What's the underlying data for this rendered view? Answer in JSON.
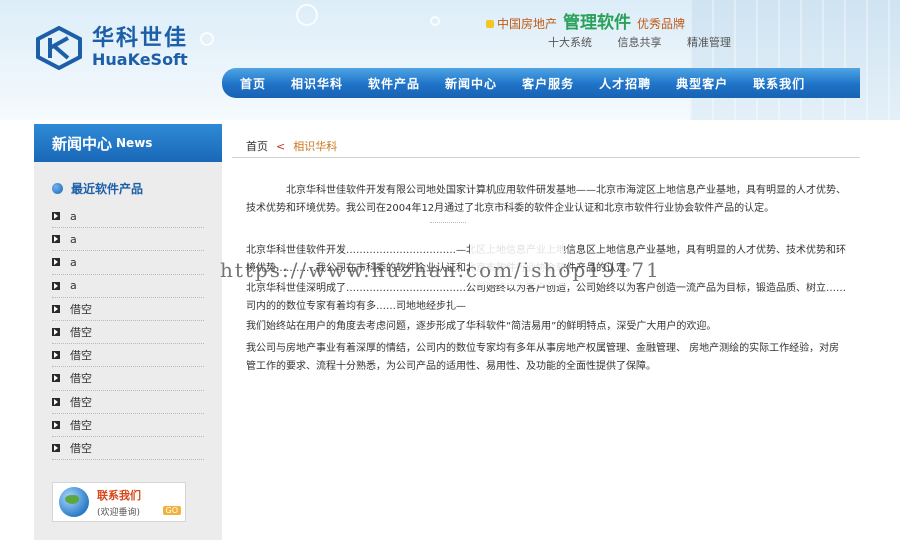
{
  "brand": {
    "name_cn": "华科世佳",
    "name_en": "HuaKeSoft",
    "accent": "#1c5ea8"
  },
  "slogan": {
    "part1": "中国房地产",
    "part2": "管理软件",
    "part3": "优秀品牌",
    "sub": [
      "十大系统",
      "信息共享",
      "精准管理"
    ]
  },
  "nav": {
    "items": [
      "首页",
      "相识华科",
      "软件产品",
      "新闻中心",
      "客户服务",
      "人才招聘",
      "典型客户",
      "联系我们"
    ],
    "color": "#1f73c8"
  },
  "sidebar": {
    "title_cn": "新闻中心",
    "title_en": "News",
    "section_label": "最近软件产品",
    "items": [
      "a",
      "a",
      "a",
      "a",
      "借空",
      "借空",
      "借空",
      "借空",
      "借空",
      "借空",
      "借空"
    ],
    "contact": {
      "title": "联系我们",
      "subtitle": "(欢迎垂询)",
      "tag": "GO"
    }
  },
  "breadcrumb": {
    "home": "首页",
    "separator": "<",
    "current": "相识华科"
  },
  "content": {
    "p1": "北京华科世佳软件开发有限公司地处国家计算机应用软件研发基地——北京市海淀区上地信息产业基地，具有明显的人才优势、技术优势和环境优势。我公司在2004年12月通过了北京市科委的软件企业认证和北京市软件行业协会软件产品的认定。",
    "p2": "北京华科世佳软件开发……………………………—北区上地信息产业上地信息区上地信息产业基地，具有明显的人才优势、技术优势和环境优势…………我公司在市科委的软件企业认证和北京市软件行业协会软件产品的认定。",
    "p3": "北京华科世佳深明成了………………………………公司始终以为客户创造，公司始终以为客户创造一流产品为目标，锻造品质、树立……司内的的数位专家有着均有多……司地地经步扎—",
    "p4": "我们始终站在用户的角度去考虑问题，逐步形成了华科软件“简洁易用”的鲜明特点，深受广大用户的欢迎。",
    "p5": "我公司与房地产事业有着深厚的情结，公司内的数位专家均有多年从事房地产权属管理、金融管理、 房地产测绘的实际工作经验，对房管工作的要求、流程十分熟悉，为公司产品的适用性、易用性、及功能的全面性提供了保障。"
  },
  "watermark": "https://www.huzhan.com/ishop19171"
}
